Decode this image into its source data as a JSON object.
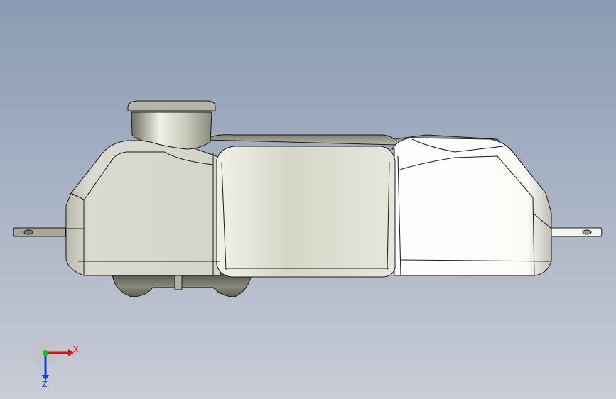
{
  "viewport": {
    "background_top": "#8a9bb3",
    "background_bottom": "#c8ccd6"
  },
  "model": {
    "body_color_light": "#ffffff",
    "body_color_mid": "#d9d9d0",
    "body_color_dark": "#7f7f70",
    "edge_color": "#1a1a1a"
  },
  "triad": {
    "x_label": "X",
    "z_label": "Z",
    "x_color": "#e01010",
    "y_color": "#10c010",
    "z_color": "#1040e0"
  }
}
